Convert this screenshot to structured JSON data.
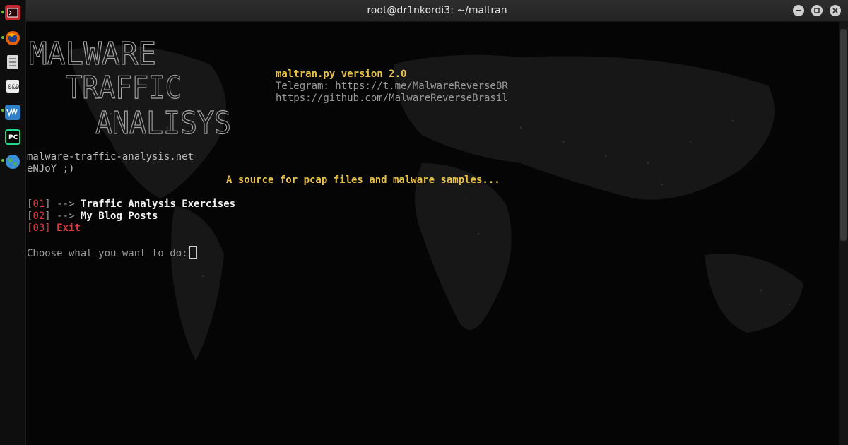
{
  "window": {
    "title": "root@dr1nkordi3: ~/maltran"
  },
  "dock": {
    "items": [
      {
        "icon": "terminal-icon",
        "color": "#c0262d"
      },
      {
        "icon": "firefox-icon",
        "color": "#e66000"
      },
      {
        "icon": "file-manager-icon",
        "color": "#cfcfcf"
      },
      {
        "icon": "hex-editor-icon",
        "color": "#e9e9e9"
      },
      {
        "icon": "vmware-icon",
        "color": "#2f7fc9"
      },
      {
        "icon": "pycharm-icon",
        "color": "#21d789"
      },
      {
        "icon": "globe-icon",
        "color": "#3a8fd6"
      }
    ]
  },
  "logo": {
    "line1": "MALWARE",
    "line2": "TRAFFIC",
    "line3": "ANALISYS"
  },
  "header": {
    "version": "maltran.py version 2.0",
    "telegram": "Telegram: https://t.me/MalwareReverseBR",
    "github": "https://github.com/MalwareReverseBrasil"
  },
  "site": {
    "url": "malware-traffic-analysis.net",
    "enjoy": "eNJoY ;)"
  },
  "tagline": "A source for pcap files and malware samples...",
  "menu": [
    {
      "num": "01",
      "arrow": "-->",
      "label": "Traffic Analysis Exercises"
    },
    {
      "num": "02",
      "arrow": "-->",
      "label": "My Blog Posts"
    },
    {
      "num": "03",
      "label": "Exit"
    }
  ],
  "prompt": "Choose what you want to do:",
  "colors": {
    "accent_yellow": "#e8c04a",
    "menu_red": "#e23b3b",
    "background": "#050505"
  }
}
